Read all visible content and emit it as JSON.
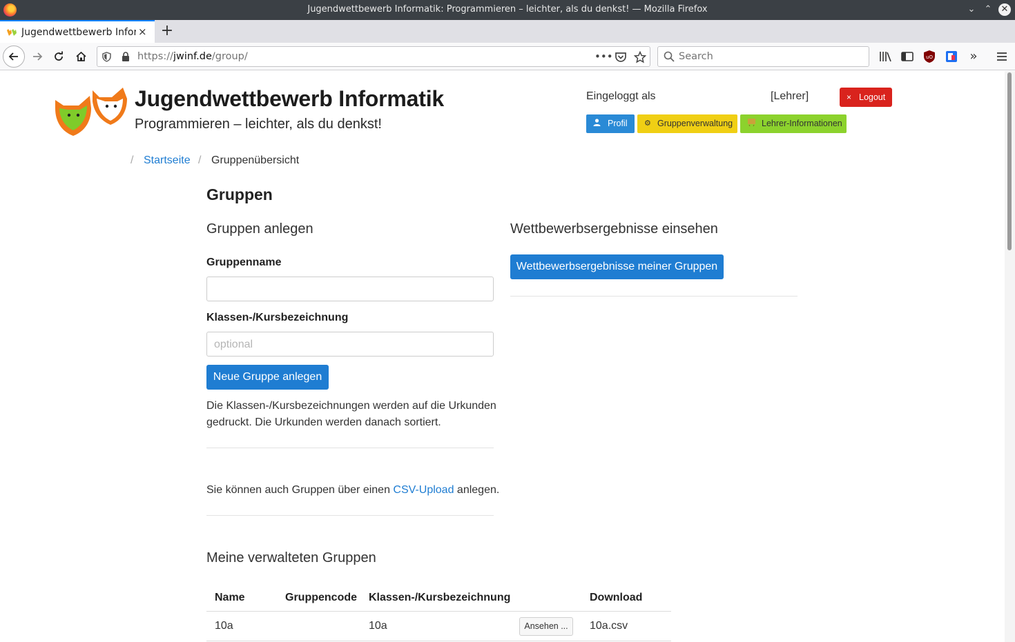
{
  "window": {
    "title": "Jugendwettbewerb Informatik: Programmieren – leichter, als du denkst! — Mozilla Firefox"
  },
  "tab": {
    "label": "Jugendwettbewerb Inform",
    "close": "×",
    "new_tab": "+"
  },
  "navbar": {
    "url_prefix": "https://",
    "url_domain": "jwinf.de",
    "url_path": "/group/",
    "page_actions": "•••",
    "search_placeholder": "Search"
  },
  "header": {
    "site_title": "Jugendwettbewerb Informatik",
    "site_subtitle": "Programmieren – leichter, als du denkst!",
    "logged_in_label": "Eingeloggt als",
    "role": "[Lehrer]",
    "logout_label": "Logout",
    "nav": {
      "profil": "Profil",
      "gruppenverwaltung": "Gruppenverwaltung",
      "lehrer_info": "Lehrer-Informationen"
    }
  },
  "breadcrumb": {
    "separator": "/",
    "home": "Startseite",
    "current": "Gruppenübersicht"
  },
  "main": {
    "heading": "Gruppen",
    "create": {
      "heading": "Gruppen anlegen",
      "group_name_label": "Gruppenname",
      "group_name_value": "",
      "class_label": "Klassen-/Kursbezeichnung",
      "class_placeholder": "optional",
      "submit_label": "Neue Gruppe anlegen",
      "note_line1": "Die Klassen-/Kursbezeichnungen werden auf die Urkunden",
      "note_line2": "gedruckt. Die Urkunden werden danach sortiert.",
      "csv_before": "Sie können auch Gruppen über einen ",
      "csv_link": "CSV-Upload",
      "csv_after": " anlegen."
    },
    "results": {
      "heading": "Wettbewerbsergebnisse einsehen",
      "button_label": "Wettbewerbsergebnisse meiner Gruppen"
    },
    "groups": {
      "heading": "Meine verwalteten Gruppen",
      "columns": [
        "Name",
        "Gruppencode",
        "Klassen-/Kursbezeichnung",
        "Download"
      ],
      "rows": [
        {
          "name": "10a",
          "code": "",
          "class": "10a",
          "view_label": "Ansehen ...",
          "download": "10a.csv"
        }
      ]
    }
  },
  "colors": {
    "primary": "#1f7dd2",
    "logout": "#d9231d",
    "profil": "#2a8ad6",
    "gruppenverwaltung": "#f0cf14",
    "lehrer": "#8cd22d"
  }
}
